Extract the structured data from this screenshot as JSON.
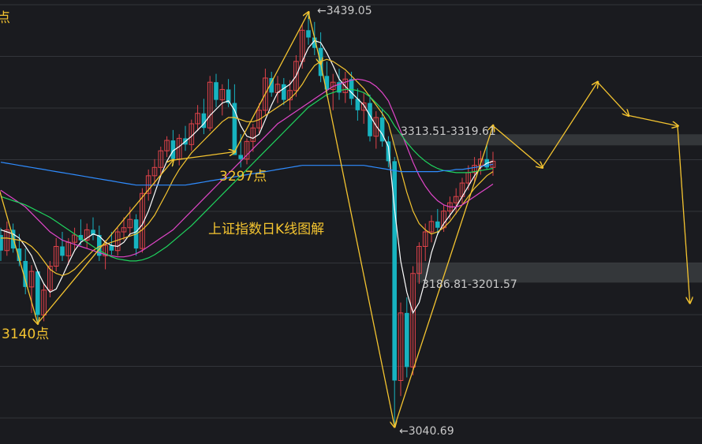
{
  "chart_data": {
    "type": "candlestick",
    "title": "上证指数日K线图解",
    "colors": {
      "background": "#1a1b1f",
      "grid": "#33353a",
      "up": "#e0434a",
      "down": "#17b3c0",
      "annotation": "#f4c430",
      "ma5": "#ffffff",
      "ma10": "#f4c430",
      "ma20": "#e046c8",
      "ma30": "#1fd45e",
      "ma60": "#2f8cff",
      "zone": "#3a3c40"
    },
    "annotations": {
      "top_left_char": "点",
      "low_left": "3140点",
      "mid_low": "3297点",
      "peak": "←3439.05",
      "bottom": "←3040.69",
      "resistance_zone": "3313.51-3319.61",
      "support_zone": "3186.81-3201.57"
    },
    "ohlc": [
      [
        3225,
        3232,
        3200,
        3210
      ],
      [
        3210,
        3238,
        3205,
        3230
      ],
      [
        3230,
        3236,
        3208,
        3212
      ],
      [
        3212,
        3226,
        3195,
        3200
      ],
      [
        3200,
        3212,
        3168,
        3175
      ],
      [
        3175,
        3196,
        3150,
        3190
      ],
      [
        3190,
        3190,
        3140,
        3148
      ],
      [
        3148,
        3178,
        3142,
        3172
      ],
      [
        3172,
        3200,
        3165,
        3195
      ],
      [
        3195,
        3222,
        3190,
        3214
      ],
      [
        3214,
        3228,
        3200,
        3205
      ],
      [
        3205,
        3222,
        3196,
        3218
      ],
      [
        3218,
        3232,
        3210,
        3225
      ],
      [
        3225,
        3240,
        3215,
        3220
      ],
      [
        3220,
        3236,
        3212,
        3230
      ],
      [
        3230,
        3242,
        3220,
        3225
      ],
      [
        3225,
        3234,
        3200,
        3205
      ],
      [
        3205,
        3220,
        3192,
        3215
      ],
      [
        3215,
        3228,
        3206,
        3210
      ],
      [
        3210,
        3232,
        3205,
        3228
      ],
      [
        3228,
        3242,
        3220,
        3232
      ],
      [
        3232,
        3252,
        3225,
        3240
      ],
      [
        3240,
        3245,
        3205,
        3212
      ],
      [
        3212,
        3270,
        3208,
        3265
      ],
      [
        3265,
        3288,
        3258,
        3282
      ],
      [
        3282,
        3298,
        3272,
        3290
      ],
      [
        3290,
        3310,
        3282,
        3306
      ],
      [
        3306,
        3320,
        3300,
        3316
      ],
      [
        3316,
        3326,
        3292,
        3298
      ],
      [
        3298,
        3322,
        3292,
        3318
      ],
      [
        3318,
        3330,
        3306,
        3312
      ],
      [
        3312,
        3336,
        3306,
        3332
      ],
      [
        3332,
        3350,
        3325,
        3342
      ],
      [
        3342,
        3356,
        3322,
        3328
      ],
      [
        3328,
        3378,
        3325,
        3372
      ],
      [
        3372,
        3380,
        3348,
        3355
      ],
      [
        3355,
        3370,
        3340,
        3365
      ],
      [
        3365,
        3375,
        3348,
        3352
      ],
      [
        3352,
        3370,
        3330,
        3302
      ],
      [
        3302,
        3322,
        3290,
        3298
      ],
      [
        3298,
        3318,
        3293,
        3315
      ],
      [
        3315,
        3332,
        3305,
        3328
      ],
      [
        3328,
        3352,
        3322,
        3345
      ],
      [
        3345,
        3385,
        3340,
        3376
      ],
      [
        3376,
        3382,
        3358,
        3362
      ],
      [
        3362,
        3378,
        3352,
        3370
      ],
      [
        3370,
        3376,
        3350,
        3355
      ],
      [
        3355,
        3374,
        3345,
        3364
      ],
      [
        3364,
        3398,
        3358,
        3392
      ],
      [
        3392,
        3428,
        3385,
        3422
      ],
      [
        3422,
        3439.05,
        3408,
        3415
      ],
      [
        3415,
        3430,
        3398,
        3405
      ],
      [
        3405,
        3420,
        3372,
        3378
      ],
      [
        3378,
        3392,
        3358,
        3365
      ],
      [
        3365,
        3380,
        3345,
        3372
      ],
      [
        3372,
        3385,
        3355,
        3362
      ],
      [
        3362,
        3382,
        3352,
        3375
      ],
      [
        3375,
        3382,
        3350,
        3356
      ],
      [
        3356,
        3366,
        3335,
        3345
      ],
      [
        3345,
        3362,
        3332,
        3352
      ],
      [
        3352,
        3360,
        3315,
        3320
      ],
      [
        3320,
        3344,
        3308,
        3338
      ],
      [
        3338,
        3346,
        3310,
        3315
      ],
      [
        3315,
        3320,
        3290,
        3296
      ],
      [
        3296,
        3300,
        3040.69,
        3085
      ],
      [
        3085,
        3160,
        3070,
        3150
      ],
      [
        3150,
        3165,
        3088,
        3098
      ],
      [
        3098,
        3195,
        3090,
        3188
      ],
      [
        3188,
        3218,
        3178,
        3214
      ],
      [
        3214,
        3236,
        3200,
        3228
      ],
      [
        3228,
        3244,
        3218,
        3238
      ],
      [
        3238,
        3250,
        3225,
        3232
      ],
      [
        3232,
        3254,
        3228,
        3248
      ],
      [
        3248,
        3262,
        3240,
        3256
      ],
      [
        3256,
        3270,
        3245,
        3262
      ],
      [
        3262,
        3280,
        3255,
        3275
      ],
      [
        3275,
        3292,
        3268,
        3285
      ],
      [
        3285,
        3300,
        3276,
        3292
      ],
      [
        3292,
        3306,
        3283,
        3298
      ],
      [
        3298,
        3312,
        3288,
        3290
      ],
      [
        3290,
        3305,
        3282,
        3296
      ]
    ],
    "ma": {
      "ma5": [
        [
          3230,
          3228,
          3226,
          3222,
          3214,
          3205,
          3190,
          3178,
          3170,
          3173,
          3185,
          3198,
          3210,
          3218,
          3222,
          3226,
          3224,
          3218,
          3215,
          3214,
          3218,
          3226,
          3228,
          3235,
          3248,
          3265,
          3282,
          3296,
          3306,
          3310,
          3315,
          3320,
          3326,
          3332,
          3340,
          3346,
          3352,
          3354,
          3345,
          3330,
          3320,
          3318,
          3322,
          3336,
          3350,
          3362,
          3366,
          3370,
          3378,
          3392,
          3405,
          3412,
          3410,
          3400,
          3388,
          3375,
          3368,
          3362,
          3356,
          3350,
          3340,
          3330,
          3322,
          3310,
          3250,
          3200,
          3170,
          3150,
          3160,
          3182,
          3208,
          3226,
          3236,
          3244,
          3252,
          3262,
          3272,
          3282,
          3290,
          3294,
          3296
        ]
      ],
      "ma10": [
        [
          3222,
          3222,
          3221,
          3220,
          3218,
          3214,
          3208,
          3200,
          3192,
          3188,
          3186,
          3188,
          3192,
          3198,
          3204,
          3210,
          3214,
          3216,
          3218,
          3220,
          3222,
          3224,
          3226,
          3230,
          3236,
          3244,
          3255,
          3266,
          3278,
          3288,
          3296,
          3304,
          3310,
          3316,
          3322,
          3328,
          3334,
          3338,
          3338,
          3336,
          3334,
          3334,
          3336,
          3340,
          3344,
          3348,
          3352,
          3356,
          3362,
          3370,
          3380,
          3388,
          3392,
          3394,
          3392,
          3388,
          3384,
          3378,
          3372,
          3366,
          3358,
          3350,
          3342,
          3332,
          3310,
          3288,
          3266,
          3248,
          3236,
          3230,
          3226,
          3228,
          3232,
          3238,
          3246,
          3254,
          3262,
          3270,
          3276,
          3282,
          3286
        ]
      ],
      "ma20": [
        [
          3268,
          3264,
          3260,
          3256,
          3252,
          3246,
          3240,
          3234,
          3228,
          3224,
          3220,
          3218,
          3216,
          3214,
          3212,
          3210,
          3208,
          3206,
          3205,
          3204,
          3204,
          3205,
          3207,
          3210,
          3214,
          3218,
          3222,
          3226,
          3230,
          3236,
          3242,
          3248,
          3254,
          3260,
          3266,
          3272,
          3278,
          3284,
          3290,
          3296,
          3302,
          3308,
          3314,
          3320,
          3326,
          3332,
          3336,
          3340,
          3344,
          3348,
          3352,
          3356,
          3360,
          3364,
          3368,
          3370,
          3372,
          3374,
          3375,
          3374,
          3372,
          3368,
          3362,
          3354,
          3340,
          3325,
          3310,
          3295,
          3282,
          3272,
          3264,
          3258,
          3254,
          3252,
          3252,
          3254,
          3258,
          3262,
          3266,
          3270,
          3274
        ]
      ],
      "ma30": [
        [
          3262,
          3260,
          3258,
          3256,
          3254,
          3251,
          3248,
          3245,
          3242,
          3238,
          3234,
          3230,
          3226,
          3222,
          3218,
          3214,
          3210,
          3207,
          3204,
          3202,
          3201,
          3200,
          3200,
          3201,
          3203,
          3206,
          3210,
          3214,
          3219,
          3224,
          3229,
          3234,
          3240,
          3246,
          3252,
          3258,
          3264,
          3270,
          3276,
          3282,
          3288,
          3294,
          3300,
          3306,
          3312,
          3318,
          3324,
          3330,
          3336,
          3342,
          3348,
          3352,
          3356,
          3360,
          3362,
          3364,
          3365,
          3365,
          3364,
          3362,
          3358,
          3352,
          3346,
          3340,
          3330,
          3322,
          3314,
          3307,
          3301,
          3296,
          3292,
          3289,
          3287,
          3286,
          3285,
          3285,
          3285,
          3286,
          3287,
          3288,
          3289
        ]
      ],
      "ma60": [
        [
          3295,
          3294,
          3293,
          3292,
          3291,
          3290,
          3289,
          3288,
          3287,
          3286,
          3285,
          3284,
          3283,
          3282,
          3281,
          3280,
          3279,
          3278,
          3277,
          3276,
          3275,
          3274,
          3273,
          3273,
          3273,
          3273,
          3273,
          3273,
          3273,
          3273,
          3273,
          3274,
          3275,
          3276,
          3277,
          3278,
          3279,
          3280,
          3281,
          3282,
          3283,
          3284,
          3285,
          3286,
          3287,
          3288,
          3289,
          3290,
          3291,
          3292,
          3292,
          3292,
          3292,
          3292,
          3292,
          3292,
          3292,
          3292,
          3292,
          3292,
          3291,
          3290,
          3289,
          3288,
          3287,
          3286,
          3286,
          3286,
          3286,
          3286,
          3286,
          3286,
          3287,
          3287,
          3288,
          3288,
          3289,
          3290,
          3291,
          3292,
          3293
        ]
      ]
    },
    "zigzag": [
      [
        -2,
        3305
      ],
      [
        6,
        3140
      ],
      [
        28,
        3297
      ],
      [
        38,
        3305
      ],
      [
        50,
        3439.05
      ],
      [
        52,
        3390
      ],
      [
        64,
        3040.69
      ],
      [
        80,
        3330
      ],
      [
        88,
        3290
      ],
      [
        97,
        3372
      ],
      [
        102,
        3340
      ],
      [
        110,
        3330
      ],
      [
        112,
        3160
      ]
    ],
    "zones": {
      "resistance": [
        3313.51,
        3319.61
      ],
      "support": [
        3186.81,
        3201.57
      ]
    },
    "y_range": [
      3030,
      3445
    ],
    "x_count": 113
  }
}
